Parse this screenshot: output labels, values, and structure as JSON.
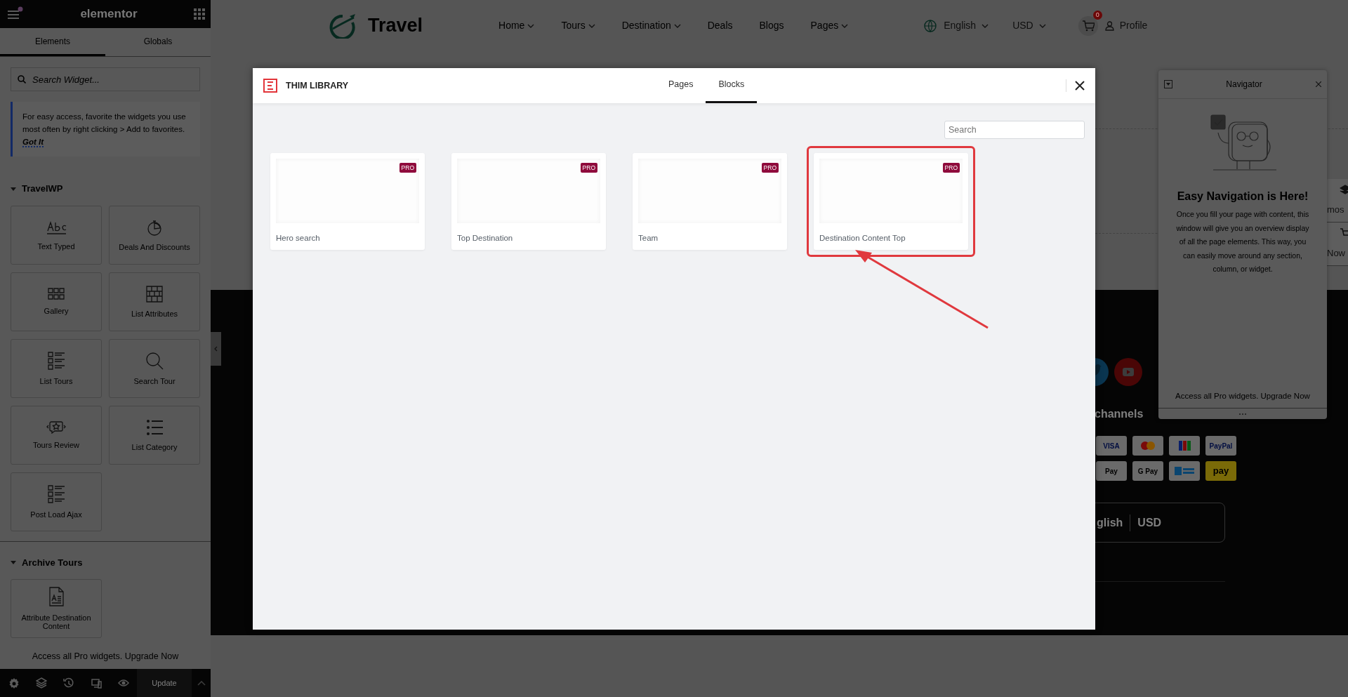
{
  "editor_panel": {
    "logo": "elementor",
    "tabs": [
      {
        "label": "Elements",
        "selected": true
      },
      {
        "label": "Globals",
        "selected": false
      }
    ],
    "search": {
      "placeholder": "Search Widget..."
    },
    "tip": {
      "text": "For easy access, favorite the widgets you use most often by right clicking > Add to favorites.",
      "link": "Got It"
    },
    "categories": [
      {
        "title": "TravelWP",
        "expanded": true,
        "widgets": [
          "Text Typed",
          "Deals And Discounts",
          "Gallery",
          "List Attributes",
          "List Tours",
          "Search Tour",
          "Tours Review",
          "List Category",
          "Post Load Ajax"
        ]
      },
      {
        "title": "Archive Tours",
        "expanded": true,
        "widgets": [
          "Attribute Destination Content"
        ]
      }
    ],
    "promo": {
      "text": "Access all Pro widgets.",
      "link": "Upgrade Now"
    },
    "update_button": "Update"
  },
  "site_header": {
    "logo": "Travel",
    "menu": [
      {
        "label": "Home",
        "dropdown": true
      },
      {
        "label": "Tours",
        "dropdown": true
      },
      {
        "label": "Destination",
        "dropdown": true
      },
      {
        "label": "Deals",
        "dropdown": false
      },
      {
        "label": "Blogs",
        "dropdown": false
      },
      {
        "label": "Pages",
        "dropdown": true
      }
    ],
    "language": "English",
    "currency": "USD",
    "cart_count": "0",
    "profile": "Profile"
  },
  "site_footer": {
    "heading": "channels",
    "payments": [
      "VISA",
      "PayPal",
      "Pay",
      "G Pay",
      "pay"
    ],
    "language": "glish",
    "currency": "USD"
  },
  "edge_labels": [
    "mos",
    "Now"
  ],
  "library_modal": {
    "title": "THIM LIBRARY",
    "tabs": [
      {
        "label": "Pages",
        "selected": false
      },
      {
        "label": "Blocks",
        "selected": true
      }
    ],
    "search": {
      "placeholder": "Search"
    },
    "blocks": [
      {
        "title": "Hero search",
        "badge": "PRO",
        "highlighted": false
      },
      {
        "title": "Top Destination",
        "badge": "PRO",
        "highlighted": false
      },
      {
        "title": "Team",
        "badge": "PRO",
        "highlighted": false
      },
      {
        "title": "Destination Content Top",
        "badge": "PRO",
        "highlighted": true
      }
    ]
  },
  "navigator": {
    "title": "Navigator",
    "heading": "Easy Navigation is Here!",
    "text": "Once you fill your page with content, this window will give you an overview display of all the page elements. This way, you can easily move around any section, column, or widget.",
    "promo": {
      "text": "Access all Pro widgets.",
      "link": "Upgrade Now"
    }
  }
}
